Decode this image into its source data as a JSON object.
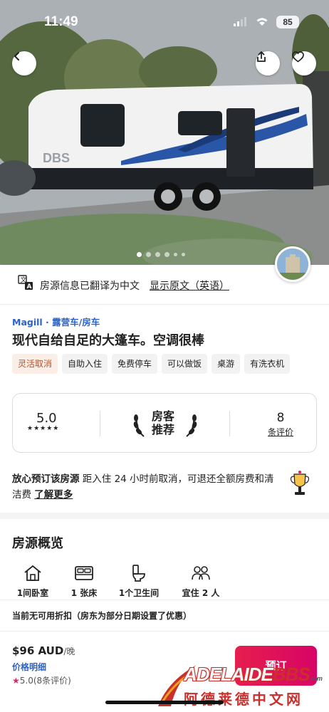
{
  "status_bar": {
    "time": "11:49",
    "battery": "85"
  },
  "hero": {
    "photo_dots_count": 6,
    "active_dot": 0
  },
  "translation": {
    "notice": "房源信息已翻译为中文",
    "show_original": "显示原文（英语）"
  },
  "listing": {
    "breadcrumb": "Magill · 露营车/房车",
    "title": "现代自给自足的大篷车。空调很棒",
    "tags": [
      "灵活取消",
      "自助入住",
      "免费停车",
      "可以做饭",
      "桌游",
      "有洗衣机"
    ]
  },
  "rating_card": {
    "score": "5.0",
    "stars": "★★★★★",
    "guest_favorite_line1": "房客",
    "guest_favorite_line2": "推荐",
    "review_count": "8",
    "review_label": "条评价"
  },
  "cancellation": {
    "bold": "放心预订该房源",
    "text": " 距入住 24 小时前取消，可退还全额房费和清洁费 ",
    "learn_more": "了解更多"
  },
  "overview": {
    "title": "房源概览",
    "items": [
      {
        "icon": "house-icon",
        "label": "1间卧室"
      },
      {
        "icon": "bed-icon",
        "label": "1 张床"
      },
      {
        "icon": "toilet-icon",
        "label": "1个卫生间"
      },
      {
        "icon": "guests-icon",
        "label": "宜住 2 人"
      }
    ],
    "discount_note": "当前无可用折扣（房东为部分日期设置了优惠）"
  },
  "booking": {
    "price": "$96 AUD",
    "unit": "/晚",
    "price_details": "价格明细",
    "rating": "5.0(8条评价)",
    "reserve": "预订"
  },
  "watermark": {
    "en_main": "ADELAIDE",
    "en_bbs": "BBS",
    "en_suffix": ".com",
    "cn": "阿德莱德中文网"
  },
  "colors": {
    "accent": "#e61e4d",
    "link_blue": "#2d62c4",
    "tag_highlight": "#b4532a"
  }
}
